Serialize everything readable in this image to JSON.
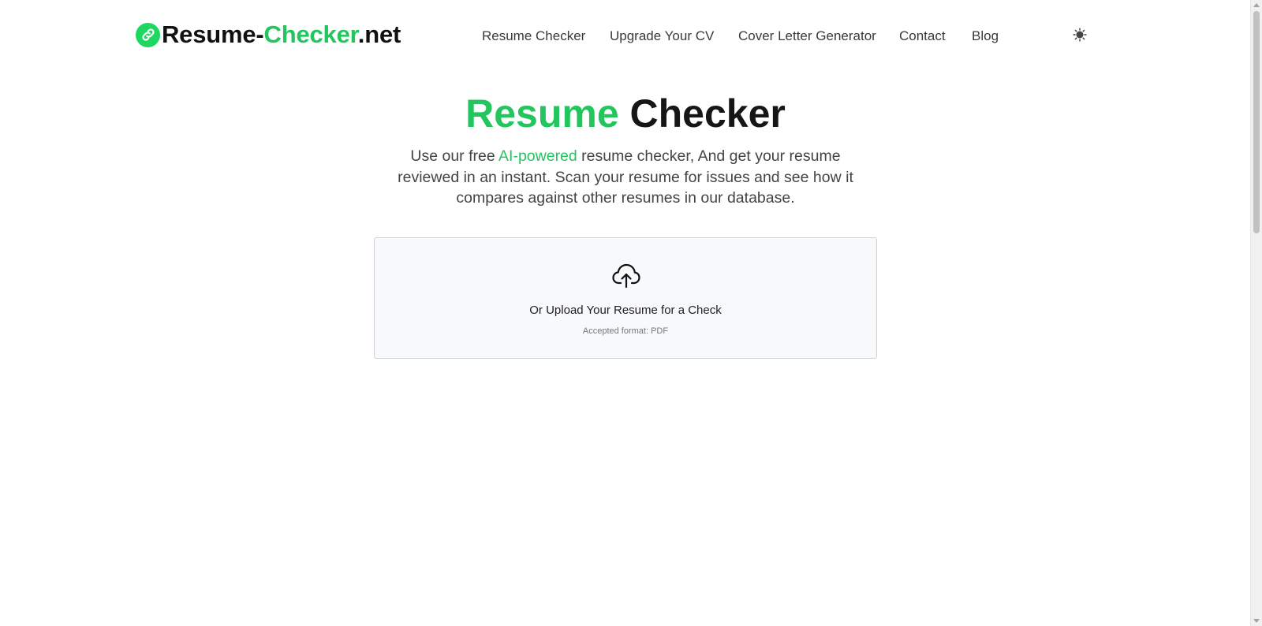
{
  "header": {
    "logo": {
      "part1": "Resume-",
      "part2": "Checker",
      "part3": ".net",
      "icon": "link-icon"
    },
    "nav": [
      {
        "label": "Resume Checker"
      },
      {
        "label": "Upgrade Your CV"
      },
      {
        "label": "Cover Letter Generator"
      },
      {
        "label": "Contact"
      },
      {
        "label": "Blog"
      }
    ],
    "theme_toggle_icon": "sun-icon"
  },
  "hero": {
    "title_accent": "Resume",
    "title_rest": " Checker",
    "subtitle_before": "Use our free ",
    "subtitle_highlight": "AI-powered",
    "subtitle_after": " resume checker, And get your resume reviewed in an instant. Scan your resume for issues and see how it compares against other resumes in our database."
  },
  "upload": {
    "icon": "cloud-upload-icon",
    "label": "Or Upload Your Resume for a Check",
    "note": "Accepted format: PDF"
  },
  "colors": {
    "brand_green": "#22c55e",
    "logo_circle": "#1ed760",
    "text_dark": "#161616"
  }
}
